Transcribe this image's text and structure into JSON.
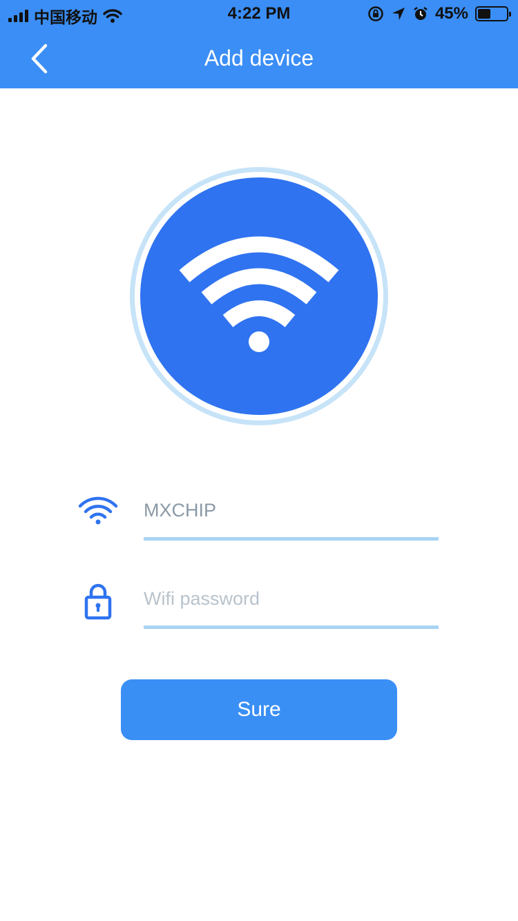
{
  "status_bar": {
    "carrier": "中国移动",
    "time": "4:22 PM",
    "battery_percent": "45%",
    "battery_level": 0.45
  },
  "header": {
    "title": "Add device",
    "back_icon": "chevron-left-icon"
  },
  "hero": {
    "icon": "wifi-icon",
    "circle_color": "#2f73f0",
    "ring_color": "#c6e3f8"
  },
  "form": {
    "ssid": {
      "icon": "wifi-icon",
      "value": "MXCHIP",
      "placeholder": ""
    },
    "password": {
      "icon": "lock-icon",
      "value": "",
      "placeholder": "Wifi password"
    },
    "submit_label": "Sure"
  },
  "colors": {
    "accent": "#3b8ef5",
    "underline": "#a8d4f4"
  }
}
